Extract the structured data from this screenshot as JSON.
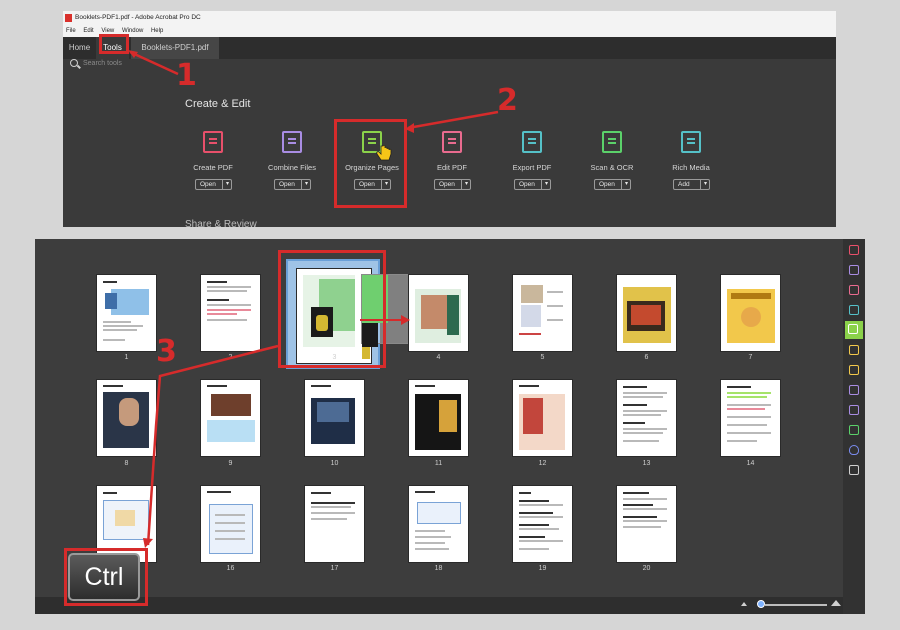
{
  "window1": {
    "title": "Booklets-PDF1.pdf - Adobe Acrobat Pro DC",
    "menu": [
      "File",
      "Edit",
      "View",
      "Window",
      "Help"
    ],
    "tabs": {
      "home": "Home",
      "tools": "Tools",
      "file": "Booklets-PDF1.pdf"
    },
    "search_placeholder": "Search tools",
    "section_heading": "Create & Edit",
    "next_section_heading": "Share & Review",
    "tools": [
      {
        "label": "Create PDF",
        "button": "Open",
        "icon": "create-pdf-icon",
        "color": "#e8506b"
      },
      {
        "label": "Combine Files",
        "button": "Open",
        "icon": "combine-files-icon",
        "color": "#a98de3"
      },
      {
        "label": "Organize Pages",
        "button": "Open",
        "icon": "organize-pages-icon",
        "color": "#8bd24a"
      },
      {
        "label": "Edit PDF",
        "button": "Open",
        "icon": "edit-pdf-icon",
        "color": "#e96b8f"
      },
      {
        "label": "Export PDF",
        "button": "Open",
        "icon": "export-pdf-icon",
        "color": "#55c1c8"
      },
      {
        "label": "Scan & OCR",
        "button": "Open",
        "icon": "scan-ocr-icon",
        "color": "#5bd16a"
      },
      {
        "label": "Rich Media",
        "button": "Add",
        "icon": "rich-media-icon",
        "color": "#55c1c8"
      }
    ]
  },
  "window2": {
    "pages": [
      "1",
      "2",
      "3",
      "4",
      "5",
      "6",
      "7",
      "8",
      "9",
      "10",
      "11",
      "12",
      "13",
      "14",
      "15",
      "16",
      "17",
      "18",
      "19",
      "20"
    ],
    "rail_icons": [
      {
        "icon": "create-pdf-icon",
        "color": "#e8506b"
      },
      {
        "icon": "combine-files-icon",
        "color": "#a98de3"
      },
      {
        "icon": "edit-pdf-icon",
        "color": "#e96b8f"
      },
      {
        "icon": "export-pdf-icon",
        "color": "#55c1c8"
      },
      {
        "icon": "organize-pages-icon",
        "color": "#8bd24a"
      },
      {
        "icon": "comment-icon",
        "color": "#f2c94c"
      },
      {
        "icon": "comment-bubble-icon",
        "color": "#f2c94c"
      },
      {
        "icon": "request-signature-icon",
        "color": "#a98de3"
      },
      {
        "icon": "fill-sign-icon",
        "color": "#a98de3"
      },
      {
        "icon": "scan-ocr-icon",
        "color": "#5bd16a"
      },
      {
        "icon": "protect-icon",
        "color": "#7b8cf0"
      },
      {
        "icon": "more-tools-icon",
        "color": "#d0d0d0"
      }
    ]
  },
  "annotations": {
    "step1": "1",
    "step2": "2",
    "step3": "3",
    "key": "Ctrl"
  },
  "colors": {
    "annotation_red": "#d62b2b",
    "selection_blue": "#9fc3e6"
  }
}
